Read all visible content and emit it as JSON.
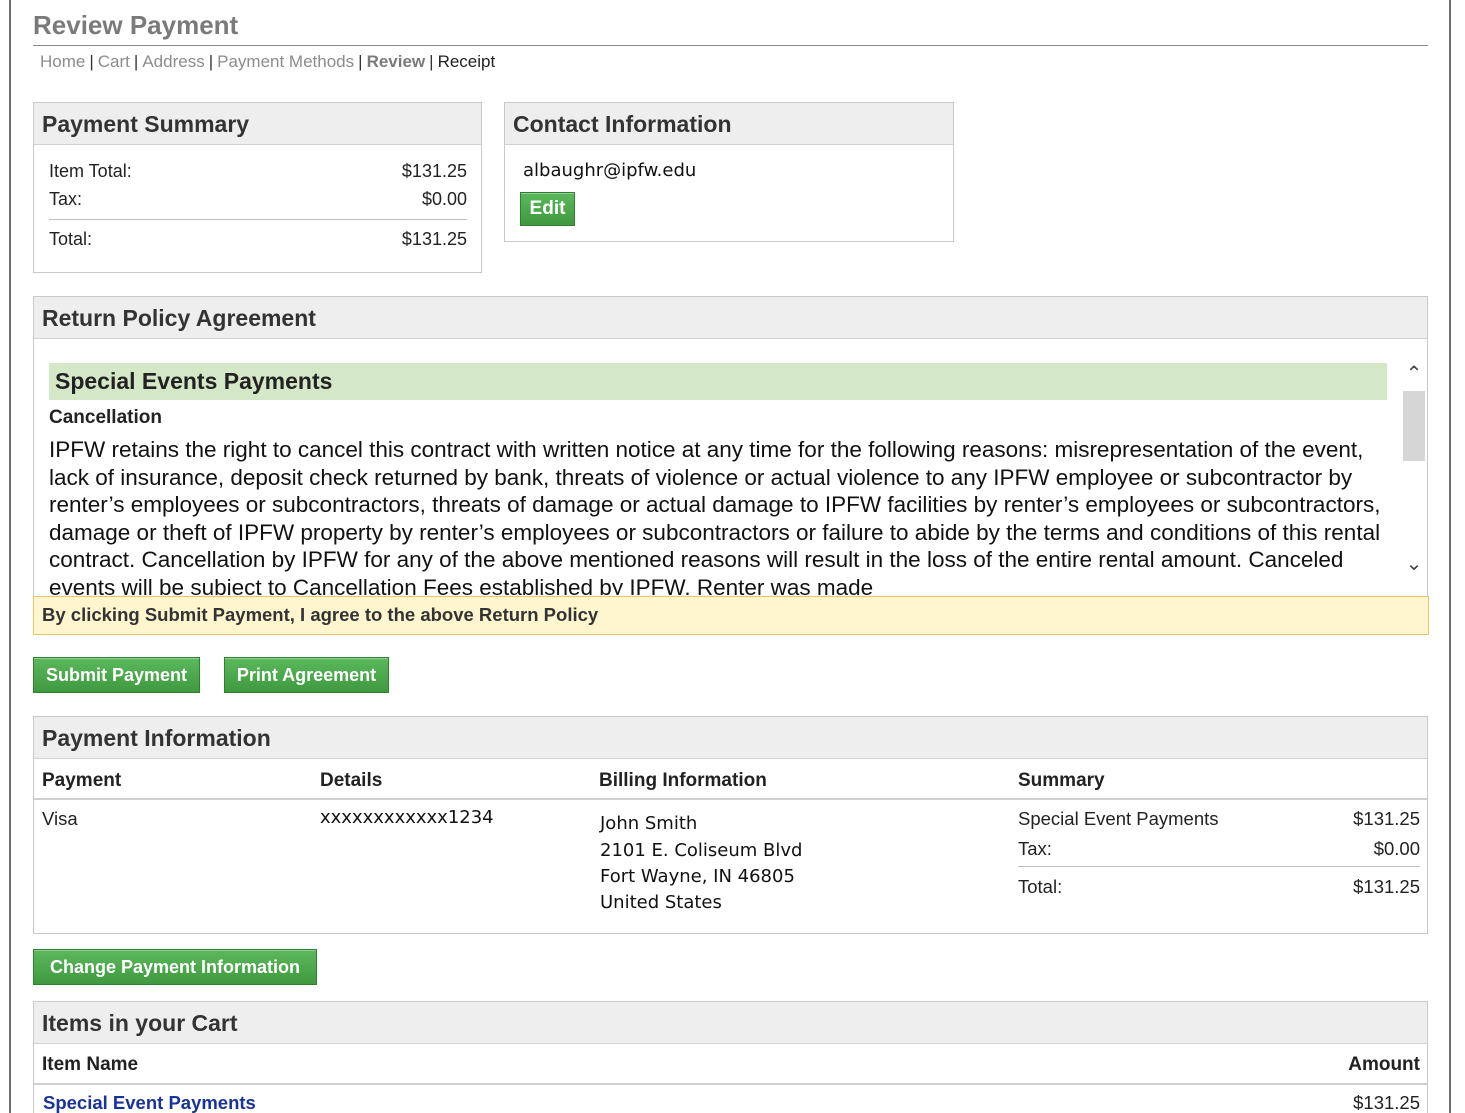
{
  "page": {
    "title": "Review Payment"
  },
  "breadcrumb": {
    "items": [
      "Home",
      "Cart",
      "Address",
      "Payment Methods",
      "Review",
      "Receipt"
    ],
    "separator": "|"
  },
  "payment_summary": {
    "title": "Payment Summary",
    "item_total_label": "Item Total:",
    "item_total_value": "$131.25",
    "tax_label": "Tax:",
    "tax_value": "$0.00",
    "total_label": "Total:",
    "total_value": "$131.25"
  },
  "contact": {
    "title": "Contact Information",
    "email": "albaughr@ipfw.edu",
    "edit_label": "Edit"
  },
  "return_policy": {
    "title": "Return Policy Agreement",
    "banner": "Special Events Payments",
    "subheading": "Cancellation",
    "text": "IPFW retains the right to cancel this contract with written notice at any time for the following reasons: misrepresentation of the event, lack of insurance, deposit check returned by bank, threats of violence or actual violence to any IPFW employee or subcontractor by renter’s employees or subcontractors, threats of damage or actual damage to IPFW facilities by renter’s employees or subcontractors, damage or theft of IPFW property by renter’s employees or subcontractors or failure to abide by the terms and conditions of this rental contract. Cancellation by IPFW for any of the above mentioned reasons will result in the loss of the entire rental amount. Canceled events will be subject to Cancellation Fees established by IPFW. Renter was made",
    "agreement": "By clicking Submit Payment, I agree to the above Return Policy"
  },
  "actions": {
    "submit_label": "Submit Payment",
    "print_label": "Print Agreement",
    "change_payment_label": "Change Payment Information"
  },
  "payment_info": {
    "title": "Payment Information",
    "headers": {
      "payment": "Payment",
      "details": "Details",
      "billing": "Billing Information",
      "summary": "Summary"
    },
    "payment_type": "Visa",
    "card_number": "xxxxxxxxxxxx1234",
    "billing": {
      "name": "John Smith",
      "street": "2101 E. Coliseum Blvd",
      "city": "Fort Wayne, IN 46805",
      "country": "United States"
    },
    "summary": {
      "item_label": "Special Event Payments",
      "item_value": "$131.25",
      "tax_label": "Tax:",
      "tax_value": "$0.00",
      "total_label": "Total:",
      "total_value": "$131.25"
    }
  },
  "cart": {
    "title": "Items in your Cart",
    "headers": {
      "name": "Item Name",
      "amount": "Amount"
    },
    "items": [
      {
        "name": "Special Event Payments",
        "amount": "$131.25"
      }
    ]
  },
  "icons": {
    "scroll_up": "chevron-up-icon",
    "scroll_down": "chevron-down-icon"
  },
  "colors": {
    "button_green": "#4cae4c",
    "banner_green": "#d4e8c8",
    "agreement_yellow": "#fff5cf",
    "link_blue": "#1a3399"
  }
}
